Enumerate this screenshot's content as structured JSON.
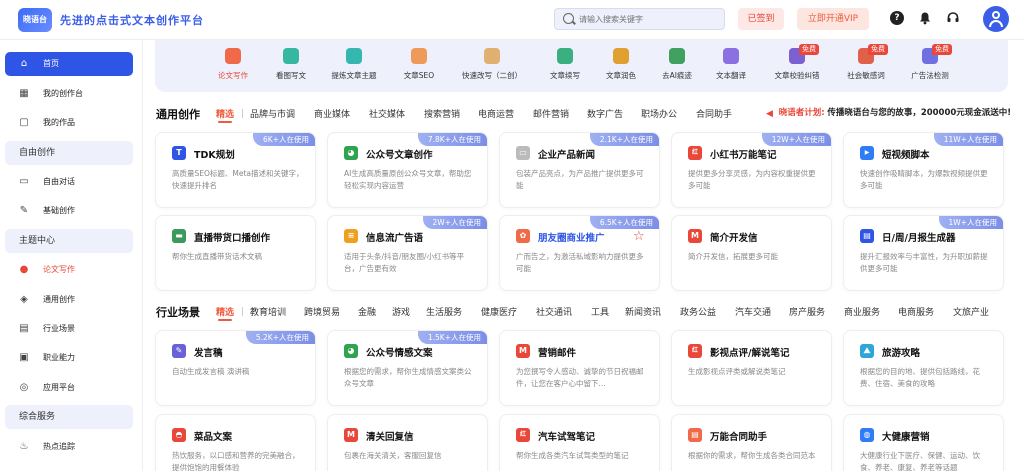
{
  "header": {
    "logo_text": "晓语台",
    "slogan": "先进的点击式文本创作平台",
    "search_placeholder": "请输入搜索关键字",
    "signed_label": "已签到",
    "vip_label": "立即开通VIP",
    "help_glyph": "?"
  },
  "sidebar": {
    "items": [
      {
        "label": "首页",
        "icon": "home-icon",
        "glyph": "⌂"
      },
      {
        "label": "我的创作台",
        "icon": "workbench-icon",
        "glyph": "▦"
      },
      {
        "label": "我的作品",
        "icon": "works-icon",
        "glyph": "▢"
      },
      {
        "label": "自由对话",
        "icon": "chat-icon",
        "glyph": "▭"
      },
      {
        "label": "基础创作",
        "icon": "edit-icon",
        "glyph": "✎"
      },
      {
        "label": "论文写作",
        "icon": "paper-icon",
        "glyph": "●"
      },
      {
        "label": "通用创作",
        "icon": "layers-icon",
        "glyph": "◈"
      },
      {
        "label": "行业场景",
        "icon": "clipboard-icon",
        "glyph": "▤"
      },
      {
        "label": "职业能力",
        "icon": "ability-icon",
        "glyph": "▣"
      },
      {
        "label": "应用平台",
        "icon": "platform-icon",
        "glyph": "◎"
      },
      {
        "label": "热点追踪",
        "icon": "trend-icon",
        "glyph": "♨"
      }
    ],
    "sections": [
      "自由创作",
      "主题中心",
      "综合服务"
    ]
  },
  "tools": [
    {
      "label": "论文写作",
      "color": "#f06a4a"
    },
    {
      "label": "看图写文",
      "color": "#35b7a0"
    },
    {
      "label": "提炼文章主题",
      "color": "#35b7b0"
    },
    {
      "label": "文章SEO",
      "color": "#f09a5a"
    },
    {
      "label": "快速改写（二创）",
      "color": "#e0b070"
    },
    {
      "label": "文章续写",
      "color": "#3ab080"
    },
    {
      "label": "文章润色",
      "color": "#e0a030"
    },
    {
      "label": "去AI痕迹",
      "color": "#40a060"
    },
    {
      "label": "文本翻译",
      "color": "#8a70e0"
    },
    {
      "label": "文章校验纠错",
      "color": "#7a60d0",
      "badge": "免费"
    },
    {
      "label": "社会敏感词",
      "color": "#e0604a",
      "badge": "免费"
    },
    {
      "label": "广告法检测",
      "color": "#7070e0",
      "badge": "免费"
    }
  ],
  "general": {
    "title": "通用创作",
    "tabs": [
      "精选",
      "品牌与市调",
      "商业媒体",
      "社交媒体",
      "搜索营销",
      "电商运营",
      "邮件营销",
      "数字广告",
      "职场办公",
      "合同助手"
    ],
    "promo_brand": "晓语者计划:",
    "promo_text": "传播晓语台与您的故事，200000元现金派送中!",
    "cards": [
      {
        "title": "TDK规划",
        "desc": "高质量SEO标题、Meta描述和关键字，快速提升排名",
        "badge": "6K+人在使用",
        "icon": "tdk-icon",
        "glyph": "T",
        "color": "#2f55e6"
      },
      {
        "title": "公众号文章创作",
        "desc": "AI生成高质量原创公众号文章，帮助您轻松实现内容运营",
        "badge": "7.8K+人在使用",
        "icon": "wechat-icon",
        "glyph": "◕",
        "color": "#2ea44f"
      },
      {
        "title": "企业产品新闻",
        "desc": "包装产品亮点，为产品推广提供更多可能",
        "badge": "2.1K+人在使用",
        "icon": "briefcase-icon",
        "glyph": "▭",
        "color": "#bbbbbb"
      },
      {
        "title": "小红书万能笔记",
        "desc": "提供更多分享灵感，为内容权重提供更多可能",
        "badge": "12W+人在使用",
        "icon": "xiaohongshu-icon",
        "glyph": "红",
        "color": "#e8473a"
      },
      {
        "title": "短视频脚本",
        "desc": "快速创作吸睛脚本，为爆款视频提供更多可能",
        "badge": "11W+人在使用",
        "icon": "video-icon",
        "glyph": "▶",
        "color": "#2f7df6"
      },
      {
        "title": "直播带货口播创作",
        "desc": "帮你生成直播带货话术文稿",
        "badge": "",
        "icon": "clapper-icon",
        "glyph": "▬",
        "color": "#3a9a5a"
      },
      {
        "title": "信息流广告语",
        "desc": "适用于头条/抖音/朋友圈/小红书等平台，广告更有效",
        "badge": "2W+人在使用",
        "icon": "doc-icon",
        "glyph": "≡",
        "color": "#f0a020"
      },
      {
        "title": "朋友圈商业推广",
        "desc": "广而告之，为激活私域影响力提供更多可能",
        "badge": "6.5K+人在使用",
        "icon": "moments-icon",
        "glyph": "✿",
        "color": "#f06a4a",
        "blue": true,
        "star": true
      },
      {
        "title": "简介开发信",
        "desc": "简介开发信，拓展更多可能",
        "badge": "",
        "icon": "gmail-icon",
        "glyph": "M",
        "color": "#e8473a"
      },
      {
        "title": "日/周/月报生成器",
        "desc": "提升汇报效率与丰富性，为升职加薪提供更多可能",
        "badge": "1W+人在使用",
        "icon": "report-icon",
        "glyph": "▤",
        "color": "#2f55e6"
      }
    ]
  },
  "industry": {
    "title": "行业场景",
    "tabs": [
      "精选",
      "教育培训",
      "跨境贸易",
      "金融",
      "游戏",
      "生活服务",
      "健康医疗",
      "社交通讯",
      "工具",
      "新闻资讯",
      "政务公益",
      "汽车交通",
      "房产服务",
      "商业服务",
      "电商服务",
      "文旅产业"
    ],
    "cards": [
      {
        "title": "发言稿",
        "desc": "自动生成发言稿 演讲稿",
        "badge": "5.2K+人在使用",
        "icon": "speech-icon",
        "glyph": "✎",
        "color": "#6a60d8"
      },
      {
        "title": "公众号情感文案",
        "desc": "根据您的需求，帮你生成情感文案类公众号文章",
        "badge": "1.5K+人在使用",
        "icon": "wechat-icon",
        "glyph": "◕",
        "color": "#2ea44f"
      },
      {
        "title": "营销邮件",
        "desc": "为您撰写令人感动、诚挚的节日祝福邮件，让您在客户心中留下...",
        "badge": "",
        "icon": "gmail-icon",
        "glyph": "M",
        "color": "#e8473a"
      },
      {
        "title": "影视点评/解说笔记",
        "desc": "生成影视点评类或解说类笔记",
        "badge": "",
        "icon": "xiaohongshu-icon",
        "glyph": "红",
        "color": "#e8473a"
      },
      {
        "title": "旅游攻略",
        "desc": "根据您的目的地、提供包括路线，花费、住宿、美食的攻略",
        "badge": "",
        "icon": "travel-icon",
        "glyph": "⛰",
        "color": "#2fa6d8"
      },
      {
        "title": "菜品文案",
        "desc": "热饮服务，以口感和营养的完美融合，提供饱饱的用餐体验",
        "badge": "",
        "icon": "dish-icon",
        "glyph": "◓",
        "color": "#e8473a"
      },
      {
        "title": "清关回复信",
        "desc": "包裹在海关清关，客服回复信",
        "badge": "",
        "icon": "gmail-icon",
        "glyph": "M",
        "color": "#e8473a"
      },
      {
        "title": "汽车试驾笔记",
        "desc": "帮你生成各类汽车试驾类型的笔记",
        "badge": "",
        "icon": "xiaohongshu-icon",
        "glyph": "红",
        "color": "#e8473a"
      },
      {
        "title": "万能合同助手",
        "desc": "根据你的需求，帮你生成各类合同范本",
        "badge": "",
        "icon": "contract-icon",
        "glyph": "▤",
        "color": "#f06a4a"
      },
      {
        "title": "大健康营销",
        "desc": "大健康行业下医疗、保健、运动、饮食、养老、康复、养老等话题",
        "badge": "",
        "icon": "health-icon",
        "glyph": "◍",
        "color": "#2f7df6"
      }
    ]
  }
}
